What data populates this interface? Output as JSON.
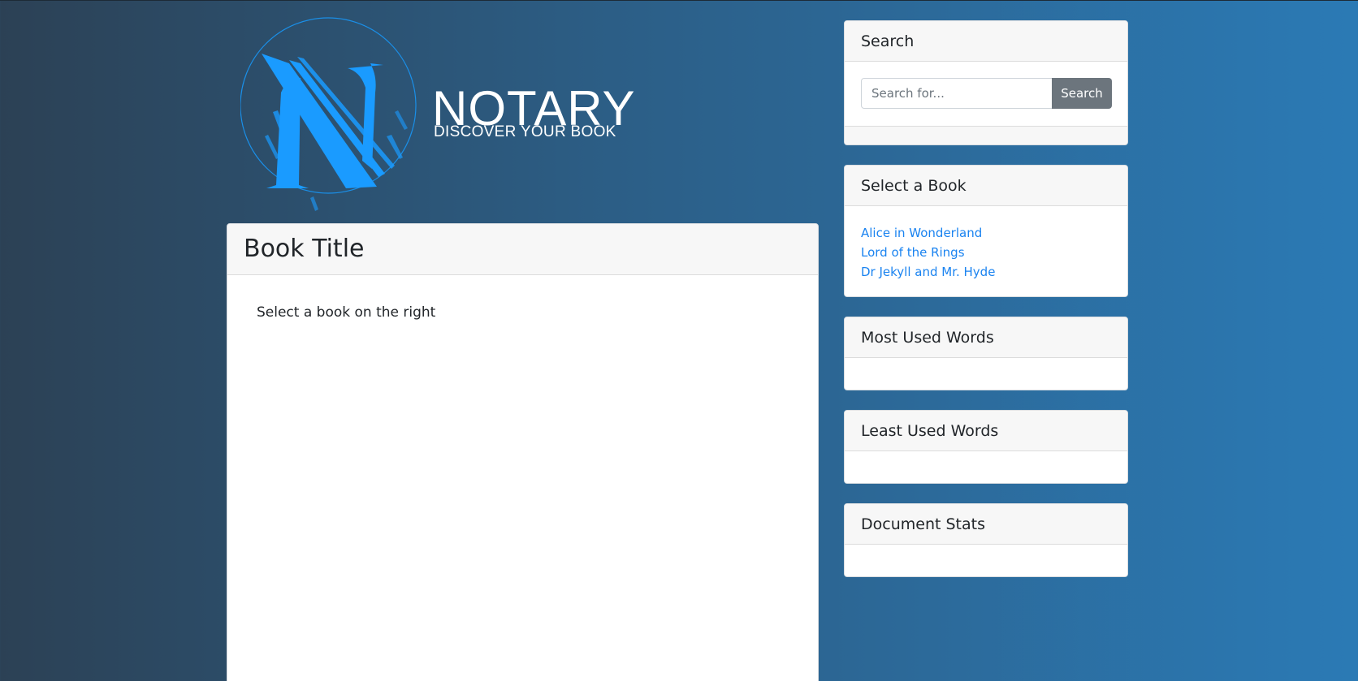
{
  "brand": {
    "name": "NOTARY",
    "tagline": "DISCOVER YOUR BOOK",
    "logo_icon": "notary-n-logo-icon",
    "accent_color": "#1a9bff"
  },
  "main": {
    "title": "Book Title",
    "placeholder_text": "Select a book on the right"
  },
  "sidebar": {
    "search": {
      "title": "Search",
      "placeholder": "Search for...",
      "button_label": "Search"
    },
    "books": {
      "title": "Select a Book",
      "items": [
        {
          "label": "Alice in Wonderland"
        },
        {
          "label": "Lord of the Rings"
        },
        {
          "label": "Dr Jekyll and Mr. Hyde"
        }
      ]
    },
    "most_used": {
      "title": "Most Used Words"
    },
    "least_used": {
      "title": "Least Used Words"
    },
    "stats": {
      "title": "Document Stats"
    }
  },
  "colors": {
    "background_start": "#2c4155",
    "background_end": "#2b7ab5",
    "link": "#1a83f0",
    "button": "#6c757d"
  }
}
